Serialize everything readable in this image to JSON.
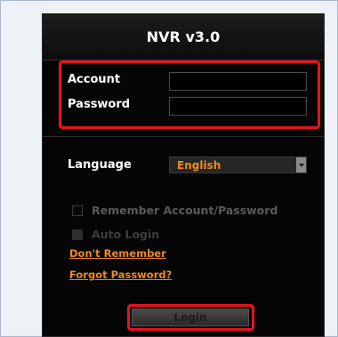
{
  "header": {
    "title": "NVR v3.0"
  },
  "credentials": {
    "account_label": "Account",
    "account_value": "",
    "password_label": "Password",
    "password_value": ""
  },
  "language": {
    "label": "Language",
    "selected": "English"
  },
  "options": {
    "remember_label": "Remember Account/Password",
    "remember_checked": false,
    "auto_login_label": "Auto Login",
    "auto_login_checked": false
  },
  "links": {
    "dont_remember": "Don't Remember",
    "forgot_password": "Forgot Password?"
  },
  "actions": {
    "login_label": "Login"
  },
  "colors": {
    "accent_orange": "#f08a1c",
    "highlight_red": "#e8121c",
    "panel_bg": "#050505"
  }
}
